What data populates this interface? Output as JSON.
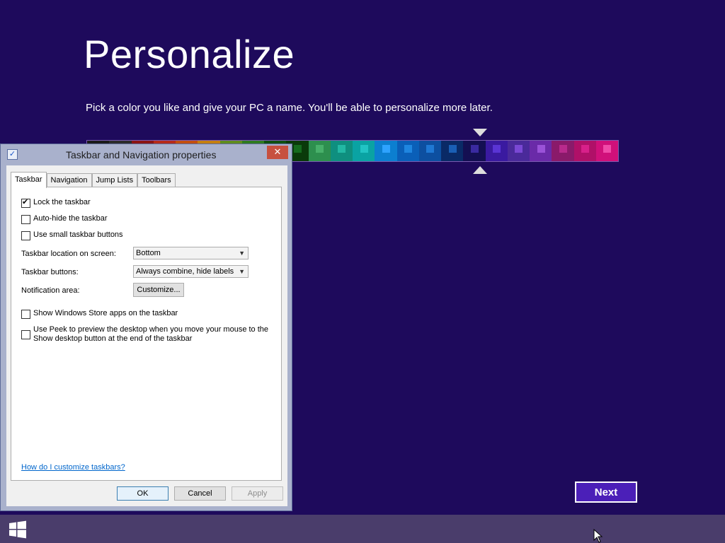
{
  "setup": {
    "title": "Personalize",
    "subtitle": "Pick a color you like and give your PC a name. You'll be able to personalize more later.",
    "next_label": "Next",
    "swatches": [
      {
        "bg": "#1a1a1a",
        "inner": "#333333"
      },
      {
        "bg": "#2b2b2b",
        "inner": "#555555"
      },
      {
        "bg": "#8b1414",
        "inner": "#b52a2a"
      },
      {
        "bg": "#b52a1a",
        "inner": "#d8442f"
      },
      {
        "bg": "#c24e10",
        "inner": "#e0702a"
      },
      {
        "bg": "#c57f10",
        "inner": "#e0a12a"
      },
      {
        "bg": "#5f8b1e",
        "inner": "#7fae2e"
      },
      {
        "bg": "#2f7a20",
        "inner": "#4c9b36"
      },
      {
        "bg": "#0f4f10",
        "inner": "#1f7a25"
      },
      {
        "bg": "#0a3a0a",
        "inner": "#156b1e"
      },
      {
        "bg": "#2d8f4e",
        "inner": "#48b06a"
      },
      {
        "bg": "#0f8f7f",
        "inner": "#22b8a4"
      },
      {
        "bg": "#0aa3a3",
        "inner": "#21c4c4"
      },
      {
        "bg": "#0c7fd0",
        "inner": "#2ea3ff"
      },
      {
        "bg": "#0a5fb8",
        "inner": "#1f86e0"
      },
      {
        "bg": "#0d4fa0",
        "inner": "#1f78d4"
      },
      {
        "bg": "#0a2a66",
        "inner": "#1a5fb5"
      },
      {
        "bg": "#140f52",
        "inner": "#3a2aa0"
      },
      {
        "bg": "#3a1aa0",
        "inner": "#5a34d4"
      },
      {
        "bg": "#4a2a9a",
        "inner": "#7a48d4"
      },
      {
        "bg": "#6a2aa8",
        "inner": "#9a52d8"
      },
      {
        "bg": "#8a1a6a",
        "inner": "#b82a8c"
      },
      {
        "bg": "#b01068",
        "inner": "#d8208a"
      },
      {
        "bg": "#d0107a",
        "inner": "#f04aa8"
      }
    ]
  },
  "dialog": {
    "title": "Taskbar and Navigation properties",
    "close_glyph": "✕",
    "tabs": [
      "Taskbar",
      "Navigation",
      "Jump Lists",
      "Toolbars"
    ],
    "active_tab": "Taskbar",
    "options": {
      "lock": {
        "label": "Lock the taskbar",
        "checked": true
      },
      "autohide": {
        "label": "Auto-hide the taskbar",
        "checked": false
      },
      "small_buttons": {
        "label": "Use small taskbar buttons",
        "checked": false
      },
      "store_apps": {
        "label": "Show Windows Store apps on the taskbar",
        "checked": false
      },
      "peek": {
        "label_line1": "Use Peek to preview the desktop when you move your mouse to the",
        "label_line2": "Show desktop button at the end of the taskbar",
        "checked": false
      }
    },
    "location_label": "Taskbar location on screen:",
    "location_value": "Bottom",
    "buttons_label": "Taskbar buttons:",
    "buttons_value": "Always combine, hide labels",
    "notification_label": "Notification area:",
    "customize_label": "Customize...",
    "help_link": "How do I customize taskbars?",
    "ok_label": "OK",
    "cancel_label": "Cancel",
    "apply_label": "Apply"
  },
  "colors": {
    "background": "#1e0a5c",
    "next_button": "#4b1fb8",
    "taskbar": "#4a3d6b",
    "close_button": "#c7503f"
  }
}
